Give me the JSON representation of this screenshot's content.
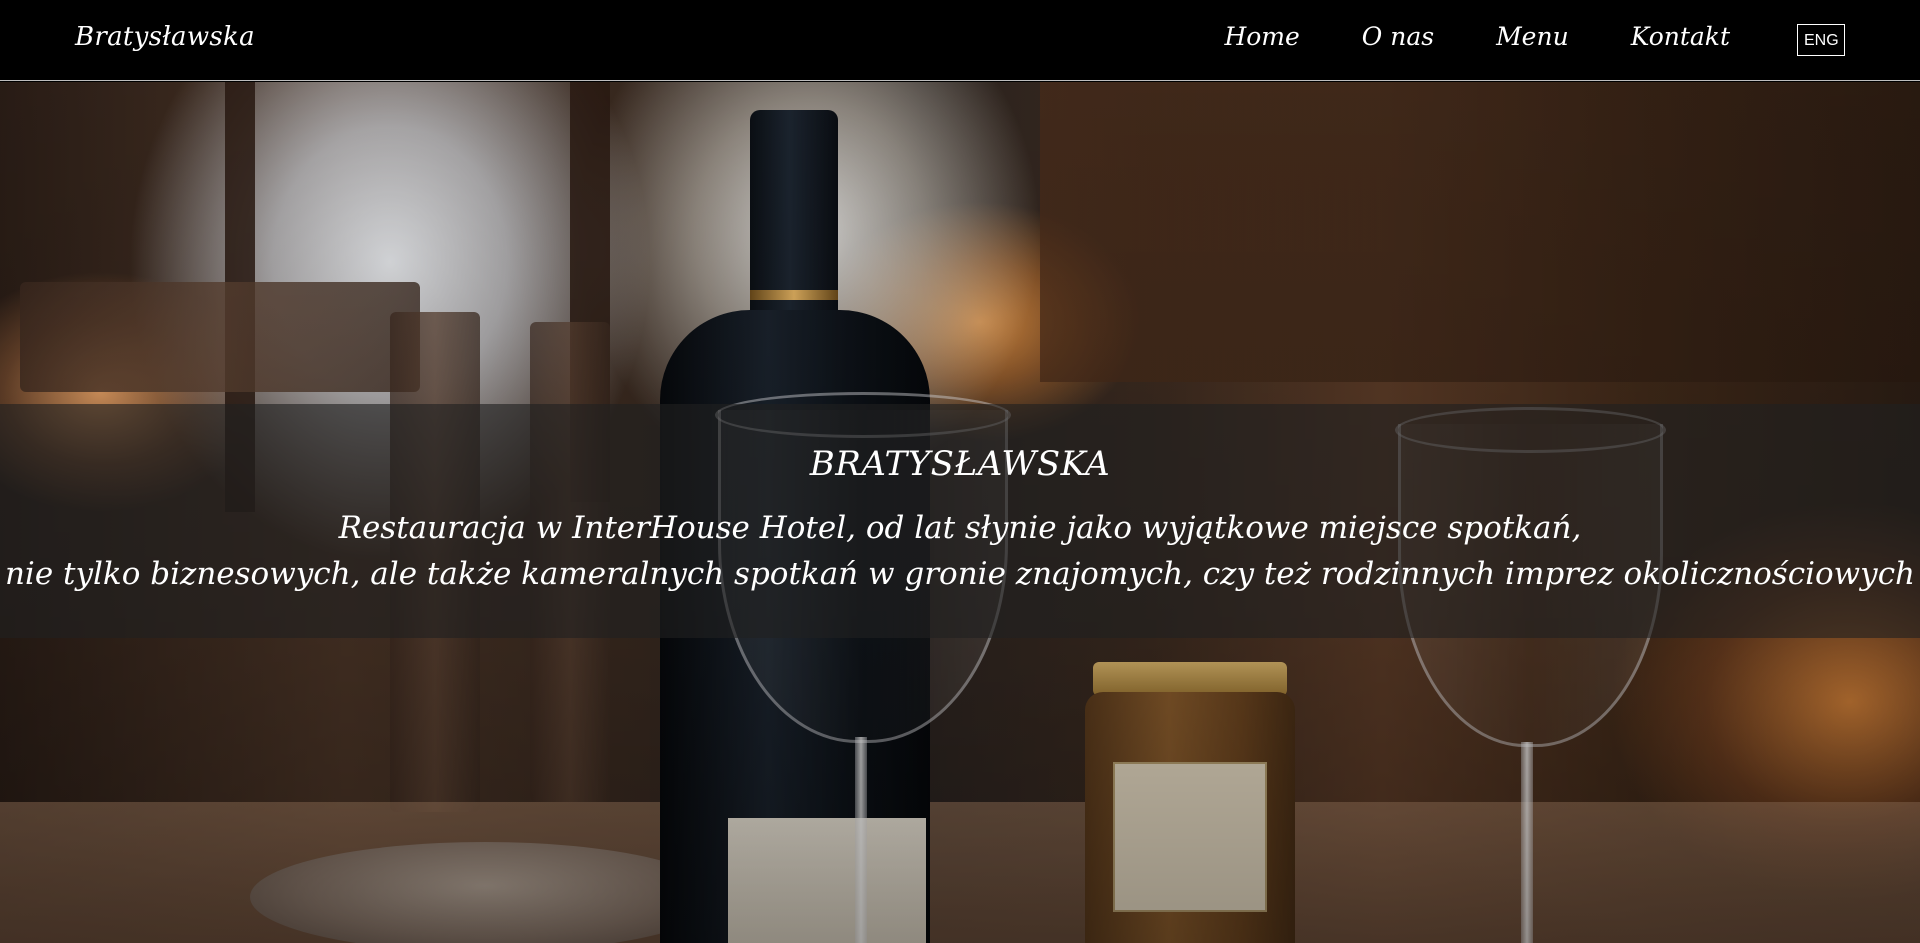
{
  "navbar": {
    "brand": "Bratysławska",
    "links": [
      {
        "label": "Home"
      },
      {
        "label": "O nas"
      },
      {
        "label": "Menu"
      },
      {
        "label": "Kontakt"
      }
    ],
    "language_button": "ENG"
  },
  "hero": {
    "title": "BRATYSŁAWSKA",
    "subtitle_line1": "Restauracja w InterHouse Hotel, od lat słynie jako wyjątkowe miejsce spotkań,",
    "subtitle_line2": "nie tylko biznesowych, ale także kameralnych spotkań w gronie znajomych, czy też rodzinnych imprez okolicznościowych"
  },
  "colors": {
    "navbar_bg": "#000000",
    "text": "#ffffff",
    "caption_band": "rgba(32,32,32,0.62)"
  }
}
